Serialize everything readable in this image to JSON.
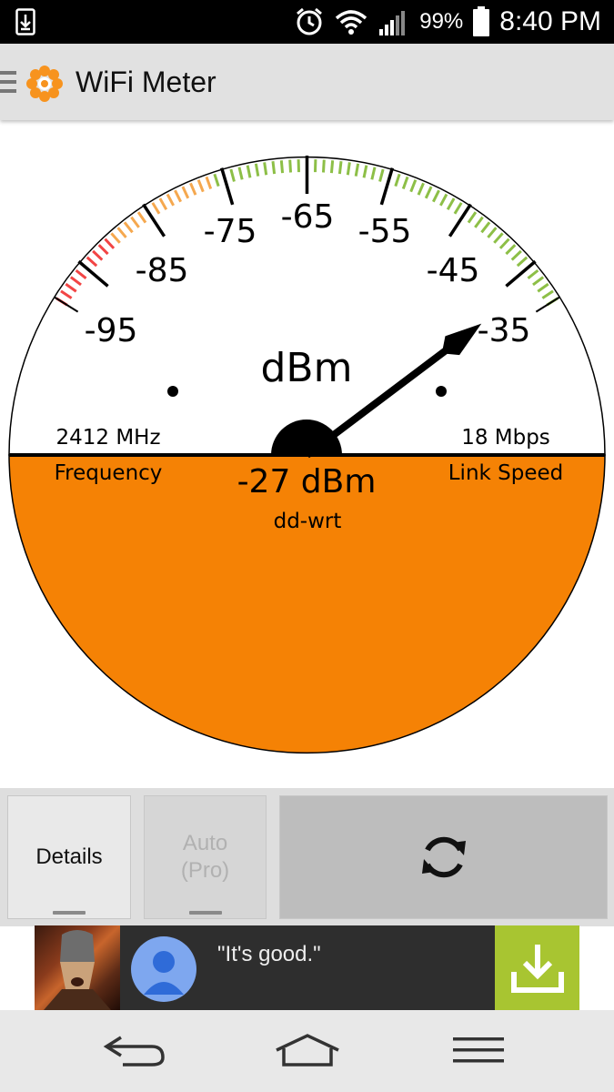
{
  "status_bar": {
    "battery": "99%",
    "time": "8:40 PM",
    "icons": [
      "download-notification-icon",
      "alarm-icon",
      "wifi-icon",
      "signal-icon",
      "battery-icon"
    ]
  },
  "app_bar": {
    "title": "WiFi Meter",
    "icons": [
      "menu-icon",
      "flower-logo-icon"
    ]
  },
  "gauge": {
    "scale_labels": [
      "-95",
      "-85",
      "-75",
      "-65",
      "-55",
      "-45",
      "-35"
    ],
    "unit": "dBm",
    "frequency_value": "2412 MHz",
    "frequency_label": "Frequency",
    "link_speed_value": "18 Mbps",
    "link_speed_label": "Link Speed",
    "signal_reading": "-27 dBm",
    "ssid": "dd-wrt",
    "scale_min": -100,
    "scale_max": -30,
    "needle_value": -33,
    "zone_colors": {
      "red": "#f24545",
      "orange": "#f5a84f",
      "green": "#8dbf47",
      "face_lower": "#f58205"
    }
  },
  "toolbar": {
    "details_label": "Details",
    "auto_label_1": "Auto",
    "auto_label_2": "(Pro)",
    "refresh_icon": "refresh-icon"
  },
  "ad": {
    "quote": "\"It's good.\"",
    "icons": [
      "game-thumbnail",
      "user-avatar-icon",
      "download-icon"
    ]
  },
  "nav_bar": {
    "icons": [
      "back-icon",
      "home-icon",
      "menu-icon"
    ]
  }
}
